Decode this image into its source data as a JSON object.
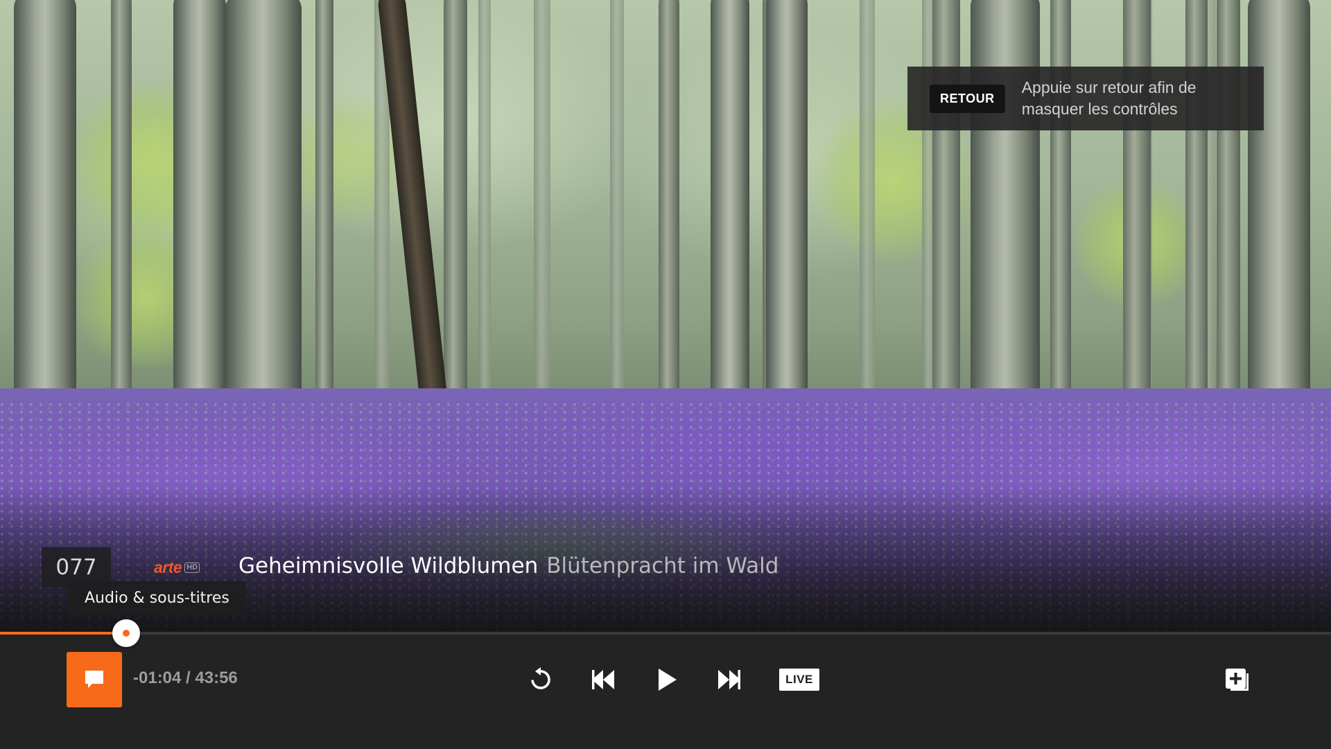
{
  "hint": {
    "key_label": "RETOUR",
    "message": "Appuie sur retour afin de masquer les contrôles"
  },
  "program": {
    "channel_number": "077",
    "channel_logo_text": "arte",
    "channel_logo_badge": "HD",
    "title": "Geheimnisvolle Wildblumen",
    "subtitle": "Blütenpracht im Wald"
  },
  "tooltip": {
    "audio_subtitles": "Audio & sous-titres"
  },
  "player": {
    "time_display": "-01:04 / 43:56",
    "progress_fraction": 0.095,
    "live_label": "LIVE",
    "accent_color": "#f56d1f"
  },
  "icons": {
    "subtitles": "speech-bubble-icon",
    "restart": "restart-icon",
    "rewind": "rewind-icon",
    "play": "play-icon",
    "fast_forward": "fast-forward-icon",
    "record": "add-recording-icon"
  }
}
